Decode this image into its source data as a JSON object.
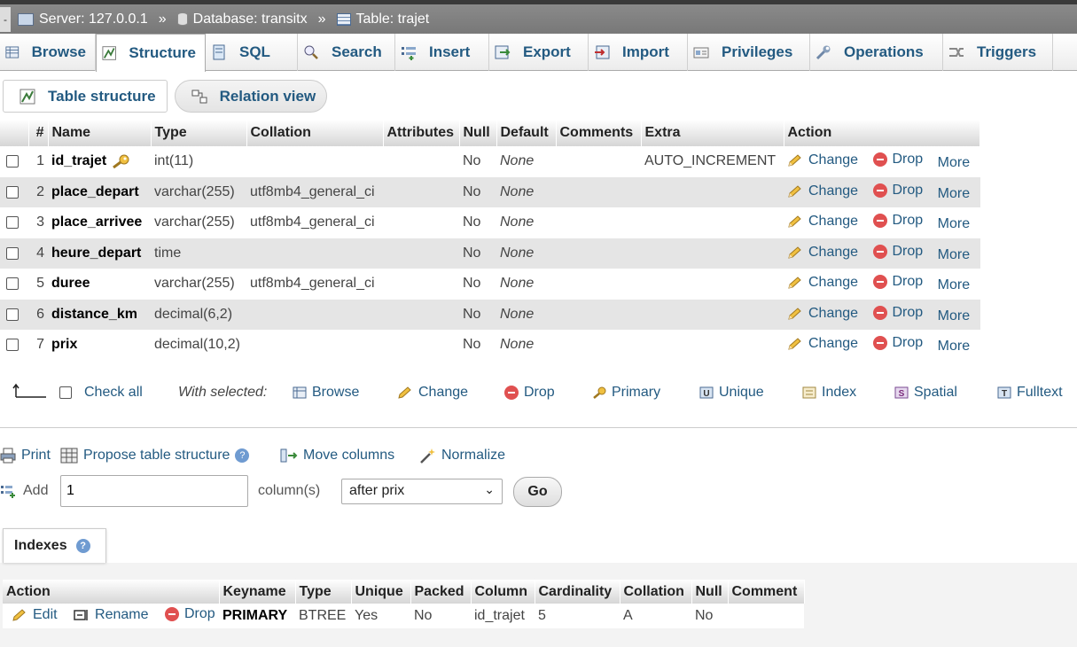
{
  "breadcrumb": {
    "server": "Server: 127.0.0.1",
    "database": "Database: transitx",
    "table": "Table: trajet",
    "separator": "»"
  },
  "tabs": [
    {
      "label": "Browse",
      "icon": "browse-icon"
    },
    {
      "label": "Structure",
      "icon": "structure-icon",
      "active": true
    },
    {
      "label": "SQL",
      "icon": "sql-icon"
    },
    {
      "label": "Search",
      "icon": "search-icon"
    },
    {
      "label": "Insert",
      "icon": "insert-icon"
    },
    {
      "label": "Export",
      "icon": "export-icon"
    },
    {
      "label": "Import",
      "icon": "import-icon"
    },
    {
      "label": "Privileges",
      "icon": "privileges-icon"
    },
    {
      "label": "Operations",
      "icon": "wrench-icon"
    },
    {
      "label": "Triggers",
      "icon": "triggers-icon"
    }
  ],
  "subtabs": {
    "structure": "Table structure",
    "relation": "Relation view"
  },
  "columns": {
    "num": "#",
    "name": "Name",
    "type": "Type",
    "collation": "Collation",
    "attributes": "Attributes",
    "null": "Null",
    "default": "Default",
    "comments": "Comments",
    "extra": "Extra",
    "action": "Action"
  },
  "actions": {
    "change": "Change",
    "drop": "Drop",
    "more": "More"
  },
  "fields": [
    {
      "num": "1",
      "name": "id_trajet",
      "type": "int(11)",
      "collation": "",
      "null": "No",
      "default": "None",
      "extra": "AUTO_INCREMENT"
    },
    {
      "num": "2",
      "name": "place_depart",
      "type": "varchar(255)",
      "collation": "utf8mb4_general_ci",
      "null": "No",
      "default": "None",
      "extra": ""
    },
    {
      "num": "3",
      "name": "place_arrivee",
      "type": "varchar(255)",
      "collation": "utf8mb4_general_ci",
      "null": "No",
      "default": "None",
      "extra": ""
    },
    {
      "num": "4",
      "name": "heure_depart",
      "type": "time",
      "collation": "",
      "null": "No",
      "default": "None",
      "extra": ""
    },
    {
      "num": "5",
      "name": "duree",
      "type": "varchar(255)",
      "collation": "utf8mb4_general_ci",
      "null": "No",
      "default": "None",
      "extra": ""
    },
    {
      "num": "6",
      "name": "distance_km",
      "type": "decimal(6,2)",
      "collation": "",
      "null": "No",
      "default": "None",
      "extra": ""
    },
    {
      "num": "7",
      "name": "prix",
      "type": "decimal(10,2)",
      "collation": "",
      "null": "No",
      "default": "None",
      "extra": ""
    }
  ],
  "with_selected": {
    "check_all": "Check all",
    "label": "With selected:",
    "browse": "Browse",
    "change": "Change",
    "drop": "Drop",
    "primary": "Primary",
    "unique": "Unique",
    "index": "Index",
    "spatial": "Spatial",
    "fulltext": "Fulltext"
  },
  "tools": {
    "print": "Print",
    "propose": "Propose table structure",
    "move": "Move columns",
    "normalize": "Normalize"
  },
  "add": {
    "label": "Add",
    "count": "1",
    "unit": "column(s)",
    "position": "after prix",
    "go": "Go"
  },
  "indexes": {
    "title": "Indexes",
    "headers": [
      "Action",
      "Keyname",
      "Type",
      "Unique",
      "Packed",
      "Column",
      "Cardinality",
      "Collation",
      "Null",
      "Comment"
    ],
    "actions": {
      "edit": "Edit",
      "rename": "Rename",
      "drop": "Drop"
    },
    "rows": [
      {
        "keyname": "PRIMARY",
        "type": "BTREE",
        "unique": "Yes",
        "packed": "No",
        "column": "id_trajet",
        "cardinality": "5",
        "collation": "A",
        "null": "No",
        "comment": ""
      }
    ]
  }
}
